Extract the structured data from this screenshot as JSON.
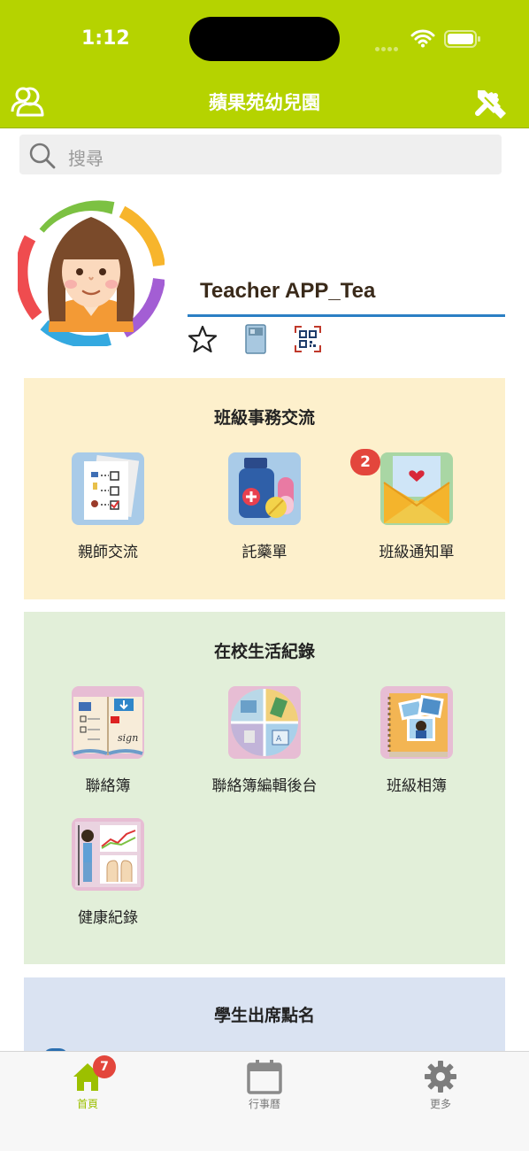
{
  "status_bar": {
    "time": "1:12"
  },
  "header": {
    "title": "蘋果苑幼兒園"
  },
  "search": {
    "placeholder": "搜尋"
  },
  "profile": {
    "name": "Teacher APP_Tea"
  },
  "sections": [
    {
      "title": "班級事務交流",
      "items": [
        {
          "label": "親師交流"
        },
        {
          "label": "託藥單"
        },
        {
          "label": "班級通知單",
          "badge": "2"
        }
      ]
    },
    {
      "title": "在校生活紀錄",
      "items": [
        {
          "label": "聯絡簿"
        },
        {
          "label": "聯絡簿編輯後台"
        },
        {
          "label": "班級相簿"
        },
        {
          "label": "健康紀錄"
        }
      ]
    },
    {
      "title": "學生出席點名",
      "items": []
    }
  ],
  "tabbar": {
    "items": [
      {
        "label": "首頁",
        "badge": "7",
        "active": true
      },
      {
        "label": "行事曆"
      },
      {
        "label": "更多"
      }
    ]
  },
  "colors": {
    "accent": "#b5d300",
    "badge": "#e3463c",
    "panel_yellow": "#fdf0cc",
    "panel_green": "#e2efd9",
    "panel_blue": "#dae3f2"
  }
}
